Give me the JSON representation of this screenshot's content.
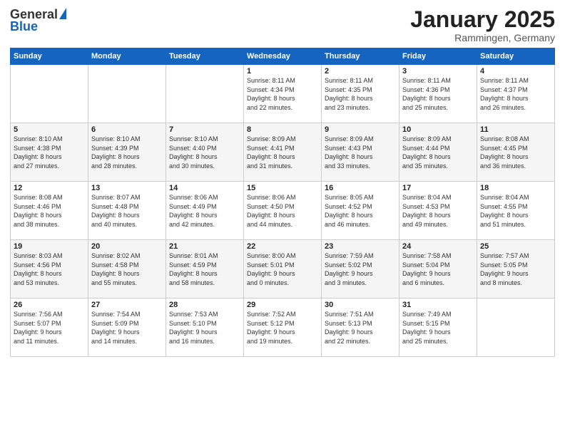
{
  "logo": {
    "general": "General",
    "blue": "Blue"
  },
  "title": {
    "month": "January 2025",
    "location": "Rammingen, Germany"
  },
  "headers": [
    "Sunday",
    "Monday",
    "Tuesday",
    "Wednesday",
    "Thursday",
    "Friday",
    "Saturday"
  ],
  "weeks": [
    [
      {
        "day": "",
        "info": ""
      },
      {
        "day": "",
        "info": ""
      },
      {
        "day": "",
        "info": ""
      },
      {
        "day": "1",
        "info": "Sunrise: 8:11 AM\nSunset: 4:34 PM\nDaylight: 8 hours\nand 22 minutes."
      },
      {
        "day": "2",
        "info": "Sunrise: 8:11 AM\nSunset: 4:35 PM\nDaylight: 8 hours\nand 23 minutes."
      },
      {
        "day": "3",
        "info": "Sunrise: 8:11 AM\nSunset: 4:36 PM\nDaylight: 8 hours\nand 25 minutes."
      },
      {
        "day": "4",
        "info": "Sunrise: 8:11 AM\nSunset: 4:37 PM\nDaylight: 8 hours\nand 26 minutes."
      }
    ],
    [
      {
        "day": "5",
        "info": "Sunrise: 8:10 AM\nSunset: 4:38 PM\nDaylight: 8 hours\nand 27 minutes."
      },
      {
        "day": "6",
        "info": "Sunrise: 8:10 AM\nSunset: 4:39 PM\nDaylight: 8 hours\nand 28 minutes."
      },
      {
        "day": "7",
        "info": "Sunrise: 8:10 AM\nSunset: 4:40 PM\nDaylight: 8 hours\nand 30 minutes."
      },
      {
        "day": "8",
        "info": "Sunrise: 8:09 AM\nSunset: 4:41 PM\nDaylight: 8 hours\nand 31 minutes."
      },
      {
        "day": "9",
        "info": "Sunrise: 8:09 AM\nSunset: 4:43 PM\nDaylight: 8 hours\nand 33 minutes."
      },
      {
        "day": "10",
        "info": "Sunrise: 8:09 AM\nSunset: 4:44 PM\nDaylight: 8 hours\nand 35 minutes."
      },
      {
        "day": "11",
        "info": "Sunrise: 8:08 AM\nSunset: 4:45 PM\nDaylight: 8 hours\nand 36 minutes."
      }
    ],
    [
      {
        "day": "12",
        "info": "Sunrise: 8:08 AM\nSunset: 4:46 PM\nDaylight: 8 hours\nand 38 minutes."
      },
      {
        "day": "13",
        "info": "Sunrise: 8:07 AM\nSunset: 4:48 PM\nDaylight: 8 hours\nand 40 minutes."
      },
      {
        "day": "14",
        "info": "Sunrise: 8:06 AM\nSunset: 4:49 PM\nDaylight: 8 hours\nand 42 minutes."
      },
      {
        "day": "15",
        "info": "Sunrise: 8:06 AM\nSunset: 4:50 PM\nDaylight: 8 hours\nand 44 minutes."
      },
      {
        "day": "16",
        "info": "Sunrise: 8:05 AM\nSunset: 4:52 PM\nDaylight: 8 hours\nand 46 minutes."
      },
      {
        "day": "17",
        "info": "Sunrise: 8:04 AM\nSunset: 4:53 PM\nDaylight: 8 hours\nand 49 minutes."
      },
      {
        "day": "18",
        "info": "Sunrise: 8:04 AM\nSunset: 4:55 PM\nDaylight: 8 hours\nand 51 minutes."
      }
    ],
    [
      {
        "day": "19",
        "info": "Sunrise: 8:03 AM\nSunset: 4:56 PM\nDaylight: 8 hours\nand 53 minutes."
      },
      {
        "day": "20",
        "info": "Sunrise: 8:02 AM\nSunset: 4:58 PM\nDaylight: 8 hours\nand 55 minutes."
      },
      {
        "day": "21",
        "info": "Sunrise: 8:01 AM\nSunset: 4:59 PM\nDaylight: 8 hours\nand 58 minutes."
      },
      {
        "day": "22",
        "info": "Sunrise: 8:00 AM\nSunset: 5:01 PM\nDaylight: 9 hours\nand 0 minutes."
      },
      {
        "day": "23",
        "info": "Sunrise: 7:59 AM\nSunset: 5:02 PM\nDaylight: 9 hours\nand 3 minutes."
      },
      {
        "day": "24",
        "info": "Sunrise: 7:58 AM\nSunset: 5:04 PM\nDaylight: 9 hours\nand 6 minutes."
      },
      {
        "day": "25",
        "info": "Sunrise: 7:57 AM\nSunset: 5:05 PM\nDaylight: 9 hours\nand 8 minutes."
      }
    ],
    [
      {
        "day": "26",
        "info": "Sunrise: 7:56 AM\nSunset: 5:07 PM\nDaylight: 9 hours\nand 11 minutes."
      },
      {
        "day": "27",
        "info": "Sunrise: 7:54 AM\nSunset: 5:09 PM\nDaylight: 9 hours\nand 14 minutes."
      },
      {
        "day": "28",
        "info": "Sunrise: 7:53 AM\nSunset: 5:10 PM\nDaylight: 9 hours\nand 16 minutes."
      },
      {
        "day": "29",
        "info": "Sunrise: 7:52 AM\nSunset: 5:12 PM\nDaylight: 9 hours\nand 19 minutes."
      },
      {
        "day": "30",
        "info": "Sunrise: 7:51 AM\nSunset: 5:13 PM\nDaylight: 9 hours\nand 22 minutes."
      },
      {
        "day": "31",
        "info": "Sunrise: 7:49 AM\nSunset: 5:15 PM\nDaylight: 9 hours\nand 25 minutes."
      },
      {
        "day": "",
        "info": ""
      }
    ]
  ]
}
